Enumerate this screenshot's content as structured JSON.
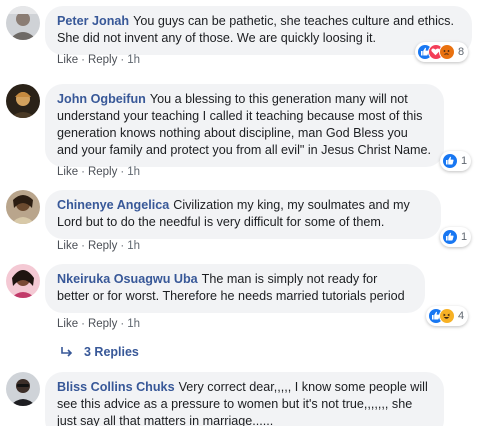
{
  "comments": [
    {
      "author": "Peter Jonah",
      "text": "You guys can be pathetic, she teaches culture and ethics. She did not invent any of those. We are quickly loosing it.",
      "like_label": "Like",
      "reply_label": "Reply",
      "time": "1h",
      "reaction_icons": [
        "like-icon",
        "love-icon",
        "angry-icon"
      ],
      "reaction_count": "8"
    },
    {
      "author": "John Ogbeifun",
      "text": "You a blessing to this generation many will not understand your teaching I called it teaching because most of this generation knows nothing about discipline, man God Bless you and your family and protect you from all evil\" in Jesus Christ Name.",
      "like_label": "Like",
      "reply_label": "Reply",
      "time": "1h",
      "reaction_icons": [
        "like-icon"
      ],
      "reaction_count": "1"
    },
    {
      "author": "Chinenye Angelica",
      "text": "Civilization my king, my soulmates and my Lord but to do the needful is very difficult for some of them.",
      "like_label": "Like",
      "reply_label": "Reply",
      "time": "1h",
      "reaction_icons": [
        "like-icon"
      ],
      "reaction_count": "1"
    },
    {
      "author": "Nkeiruka Osuagwu Uba",
      "text": "The man is simply not ready for better or for worst. Therefore he needs married tutorials period",
      "like_label": "Like",
      "reply_label": "Reply",
      "time": "1h",
      "reaction_icons": [
        "like-icon",
        "haha-icon"
      ],
      "reaction_count": "4",
      "replies_label": "3 Replies"
    },
    {
      "author": "Bliss Collins Chuks",
      "text": "Very correct dear,,,,, I know some people will see this advice as a pressure to women but it's not true,,,,,,, she just say all that matters in marriage......"
    }
  ],
  "colors": {
    "author": "#385898",
    "bubble": "#f2f3f5",
    "like": "#1877f2",
    "love": "#f33e58",
    "angry": "#e9710f",
    "haha": "#f7b125"
  }
}
